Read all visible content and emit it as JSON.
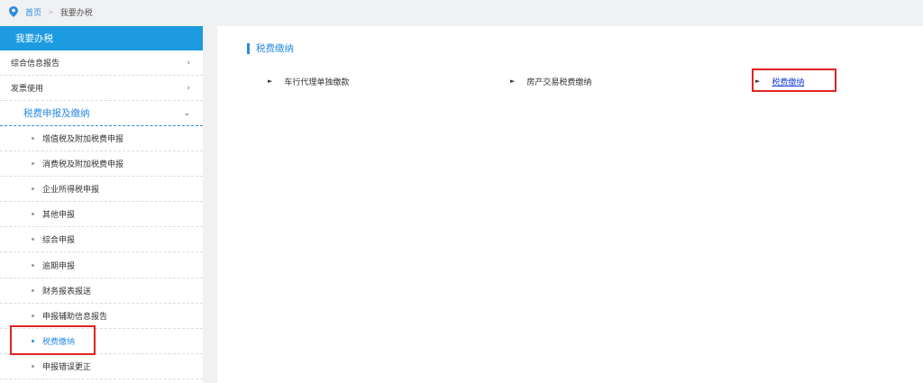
{
  "breadcrumb": {
    "home": "首页",
    "separator": ">",
    "current": "我要办税"
  },
  "sidebar": {
    "title": "我要办税",
    "top_items": [
      {
        "label": "综合信息报告",
        "chevron": "›"
      },
      {
        "label": "发票使用",
        "chevron": "›"
      }
    ],
    "group": {
      "label": "税费申报及缴纳",
      "chevron": "⌄"
    },
    "sub_items": [
      "增值税及附加税费申报",
      "消费税及附加税费申报",
      "企业所得税申报",
      "其他申报",
      "综合申报",
      "逾期申报",
      "财务报表报送",
      "申报辅助信息报告",
      "税费缴纳",
      "申报错误更正"
    ],
    "active_item": "税费缴纳"
  },
  "content": {
    "section_title": "税费缴纳",
    "items": [
      {
        "label": "车行代理单独缴款"
      },
      {
        "label": "房产交易税费缴纳"
      },
      {
        "label": "税费缴纳"
      }
    ]
  },
  "colors": {
    "accent": "#1c9be0",
    "link": "#1c3fd8",
    "highlight": "#e02222"
  }
}
